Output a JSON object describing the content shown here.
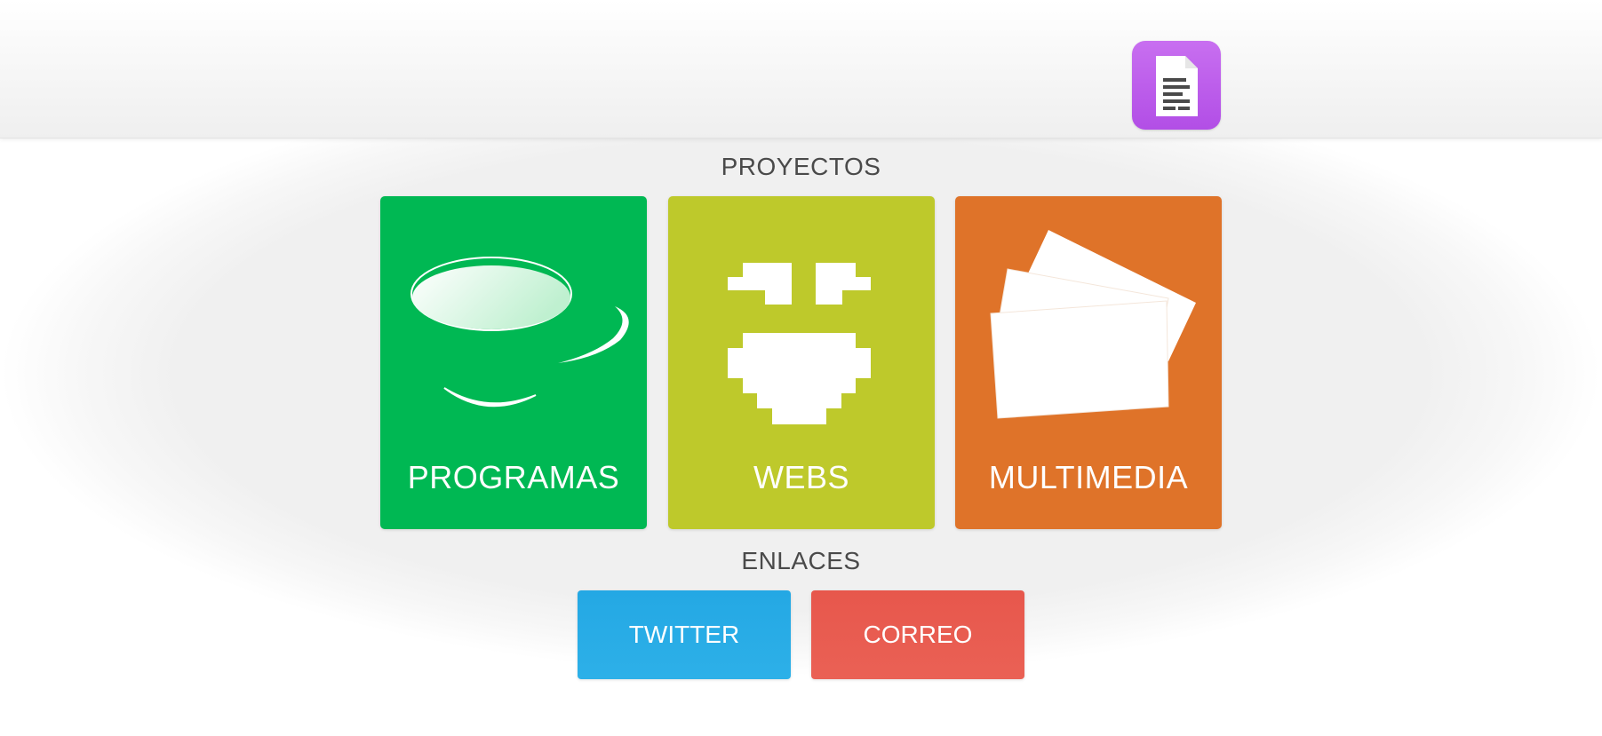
{
  "header": {
    "doc_button": {
      "icon": "document-icon",
      "color": "#b24ee6"
    }
  },
  "sections": {
    "proyectos": {
      "title": "PROYECTOS",
      "tiles": [
        {
          "label": "PROGRAMAS",
          "icon": "teacup-icon",
          "color": "#00b853"
        },
        {
          "label": "WEBS",
          "icon": "pixel-face-icon",
          "color": "#bec92b"
        },
        {
          "label": "MULTIMEDIA",
          "icon": "photo-stack-icon",
          "color": "#df7329"
        }
      ]
    },
    "enlaces": {
      "title": "ENLACES",
      "buttons": [
        {
          "label": "TWITTER",
          "color": "#24a8e4"
        },
        {
          "label": "CORREO",
          "color": "#e7574c"
        }
      ]
    }
  }
}
